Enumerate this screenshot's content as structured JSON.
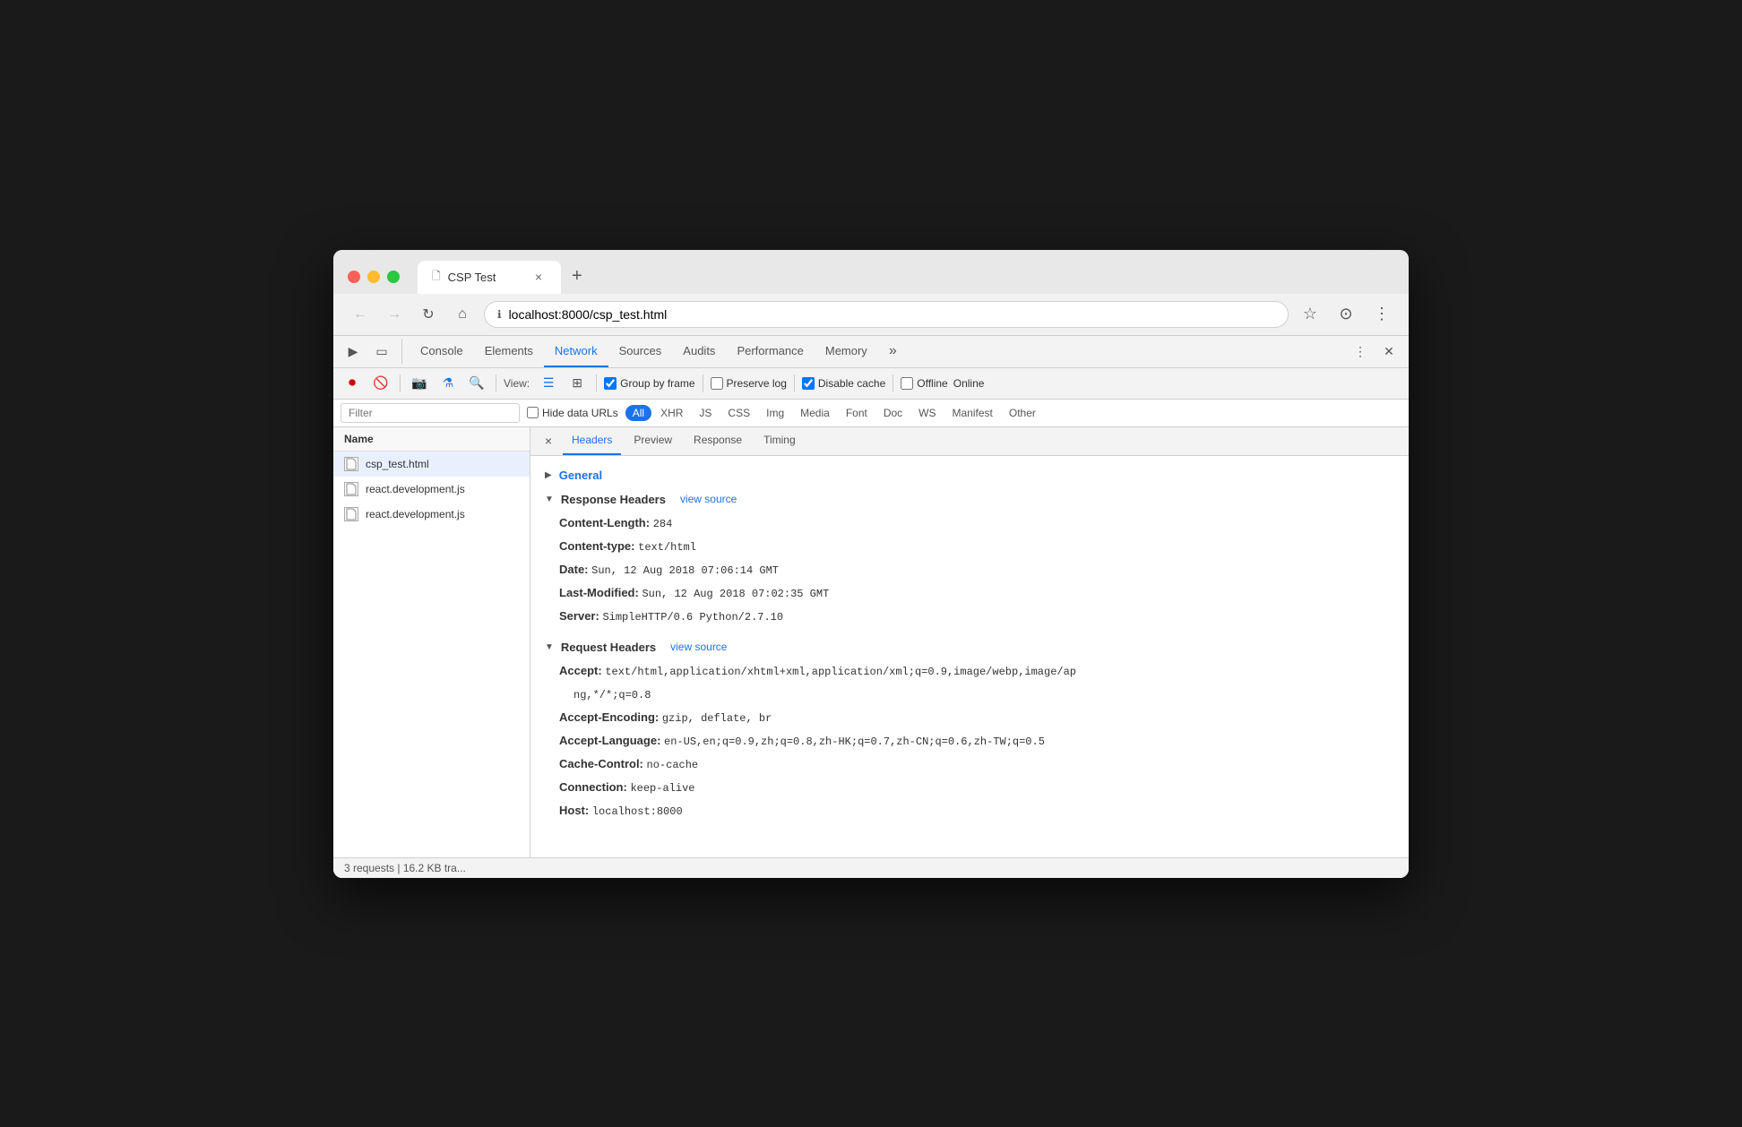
{
  "browser": {
    "tab": {
      "title": "CSP Test",
      "close_btn": "×"
    },
    "new_tab_btn": "+",
    "url": "localhost:8000/csp_test.html",
    "url_prefix": "localhost",
    "url_suffix": ":8000/csp_test.html"
  },
  "devtools": {
    "tabs": [
      "Console",
      "Elements",
      "Network",
      "Sources",
      "Audits",
      "Performance",
      "Memory"
    ],
    "active_tab": "Network",
    "more_btn": "»",
    "close_btn": "✕"
  },
  "network_toolbar": {
    "view_label": "View:",
    "group_by_frame_label": "Group by frame",
    "group_by_frame_checked": true,
    "preserve_log_label": "Preserve log",
    "preserve_log_checked": false,
    "disable_cache_label": "Disable cache",
    "disable_cache_checked": true,
    "offline_label": "Offline",
    "offline_checked": false,
    "online_label": "Online"
  },
  "filter_bar": {
    "placeholder": "Filter",
    "hide_data_urls_label": "Hide data URLs",
    "hide_data_urls_checked": false,
    "type_filters": [
      "All",
      "XHR",
      "JS",
      "CSS",
      "Img",
      "Media",
      "Font",
      "Doc",
      "WS",
      "Manifest",
      "Other"
    ],
    "active_type": "All"
  },
  "file_list": {
    "header": "Name",
    "items": [
      {
        "name": "csp_test.html",
        "selected": true
      },
      {
        "name": "react.development.js",
        "selected": false
      },
      {
        "name": "react.development.js",
        "selected": false
      }
    ]
  },
  "sub_tabs": {
    "close_btn": "×",
    "tabs": [
      "Headers",
      "Preview",
      "Response",
      "Timing"
    ],
    "active_tab": "Headers"
  },
  "headers": {
    "general_section": "General",
    "response_headers": {
      "title": "Response Headers",
      "view_source": "view source",
      "items": [
        {
          "key": "Content-Length:",
          "value": "284"
        },
        {
          "key": "Content-type:",
          "value": "text/html"
        },
        {
          "key": "Date:",
          "value": "Sun, 12 Aug 2018 07:06:14 GMT"
        },
        {
          "key": "Last-Modified:",
          "value": "Sun, 12 Aug 2018 07:02:35 GMT"
        },
        {
          "key": "Server:",
          "value": "SimpleHTTP/0.6 Python/2.7.10"
        }
      ]
    },
    "request_headers": {
      "title": "Request Headers",
      "view_source": "view source",
      "items": [
        {
          "key": "Accept:",
          "value": "text/html,application/xhtml+xml,application/xml;q=0.9,image/webp,image/ap"
        },
        {
          "key": "",
          "value": "ng,*/*;q=0.8"
        },
        {
          "key": "Accept-Encoding:",
          "value": "gzip, deflate, br"
        },
        {
          "key": "Accept-Language:",
          "value": "en-US,en;q=0.9,zh;q=0.8,zh-HK;q=0.7,zh-CN;q=0.6,zh-TW;q=0.5"
        },
        {
          "key": "Cache-Control:",
          "value": "no-cache"
        },
        {
          "key": "Connection:",
          "value": "keep-alive"
        },
        {
          "key": "Host:",
          "value": "localhost:8000"
        }
      ]
    }
  },
  "status_bar": {
    "text": "3 requests | 16.2 KB tra..."
  },
  "colors": {
    "active_tab": "#1a73e8",
    "record_btn": "#c00",
    "link": "#1a73e8"
  }
}
